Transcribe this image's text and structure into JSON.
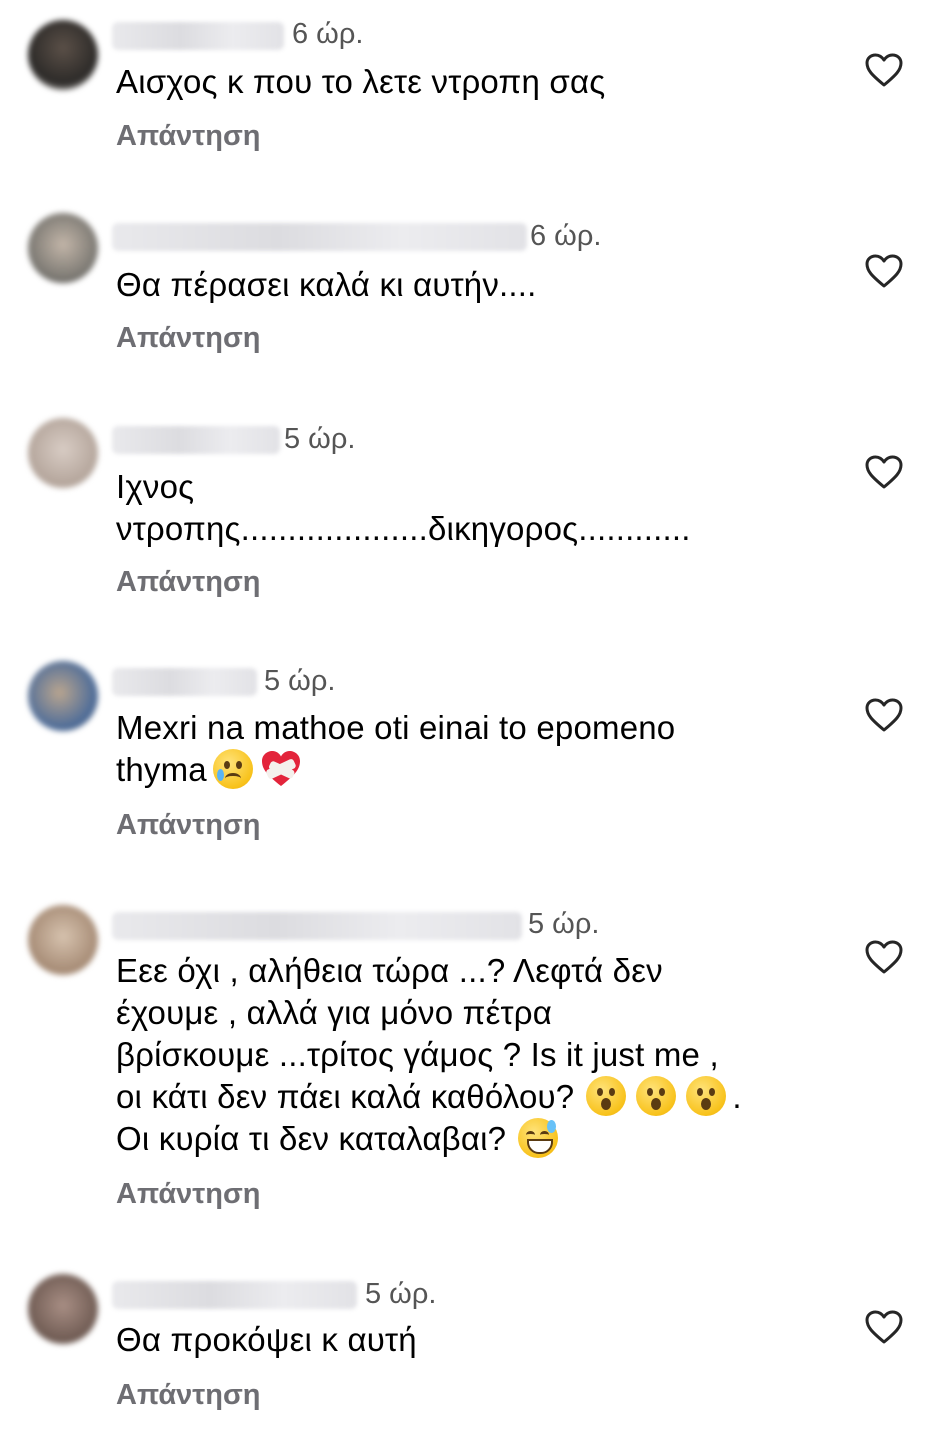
{
  "comments": [
    {
      "time": "6 ώρ.",
      "text_lines": [
        "Αισχος κ που το λετε ντροπη σας"
      ],
      "reply": "Απάντηση",
      "avatar_colors": [
        "#2c2a28",
        "#5b5048"
      ]
    },
    {
      "time": "6 ώρ.",
      "text_lines": [
        "Θα πέρασει καλά κι αυτήν...."
      ],
      "reply": "Απάντηση",
      "avatar_colors": [
        "#7d7a74",
        "#c2b5a8"
      ]
    },
    {
      "time": "5 ώρ.",
      "text_lines": [
        "Ιχνος",
        "ντροπης....................δικηγορος............"
      ],
      "reply": "Απάντηση",
      "avatar_colors": [
        "#b3a49a",
        "#d8ccc4"
      ]
    },
    {
      "time": "5 ώρ.",
      "text_lines": [
        "Mexri na mathoe oti einai to epomeno",
        "thyma"
      ],
      "reply": "Απάντηση",
      "avatar_colors": [
        "#4f6d99",
        "#b9a58f"
      ]
    },
    {
      "time": "5 ώρ.",
      "text_lines": [
        "Εεε όχι , αλήθεια τώρα ...? Λεφτά δεν",
        "έχουμε , αλλά για μόνο πέτρα",
        "βρίσκουμε ...τρίτος γάμος ? Is it just me ,",
        "οι κάτι δεν πάει καλά καθόλου?",
        "Οι κυρία τι δεν καταλαβαι?"
      ],
      "reply": "Απάντηση",
      "avatar_colors": [
        "#a58a74",
        "#d6c2ae"
      ]
    },
    {
      "time": "5 ώρ.",
      "text_lines": [
        "Θα προκόψει κ αυτή"
      ],
      "reply": "Απάντηση",
      "avatar_colors": [
        "#6e5a52",
        "#a88e84"
      ]
    }
  ],
  "emoji_names": [
    "crying-face",
    "mending-heart",
    "hushed-face",
    "grinning-sweat-face"
  ],
  "colors": {
    "reply": "#6e6e73",
    "time": "#555555",
    "heart_outline": "#262626"
  },
  "after_emoji_punct": "."
}
